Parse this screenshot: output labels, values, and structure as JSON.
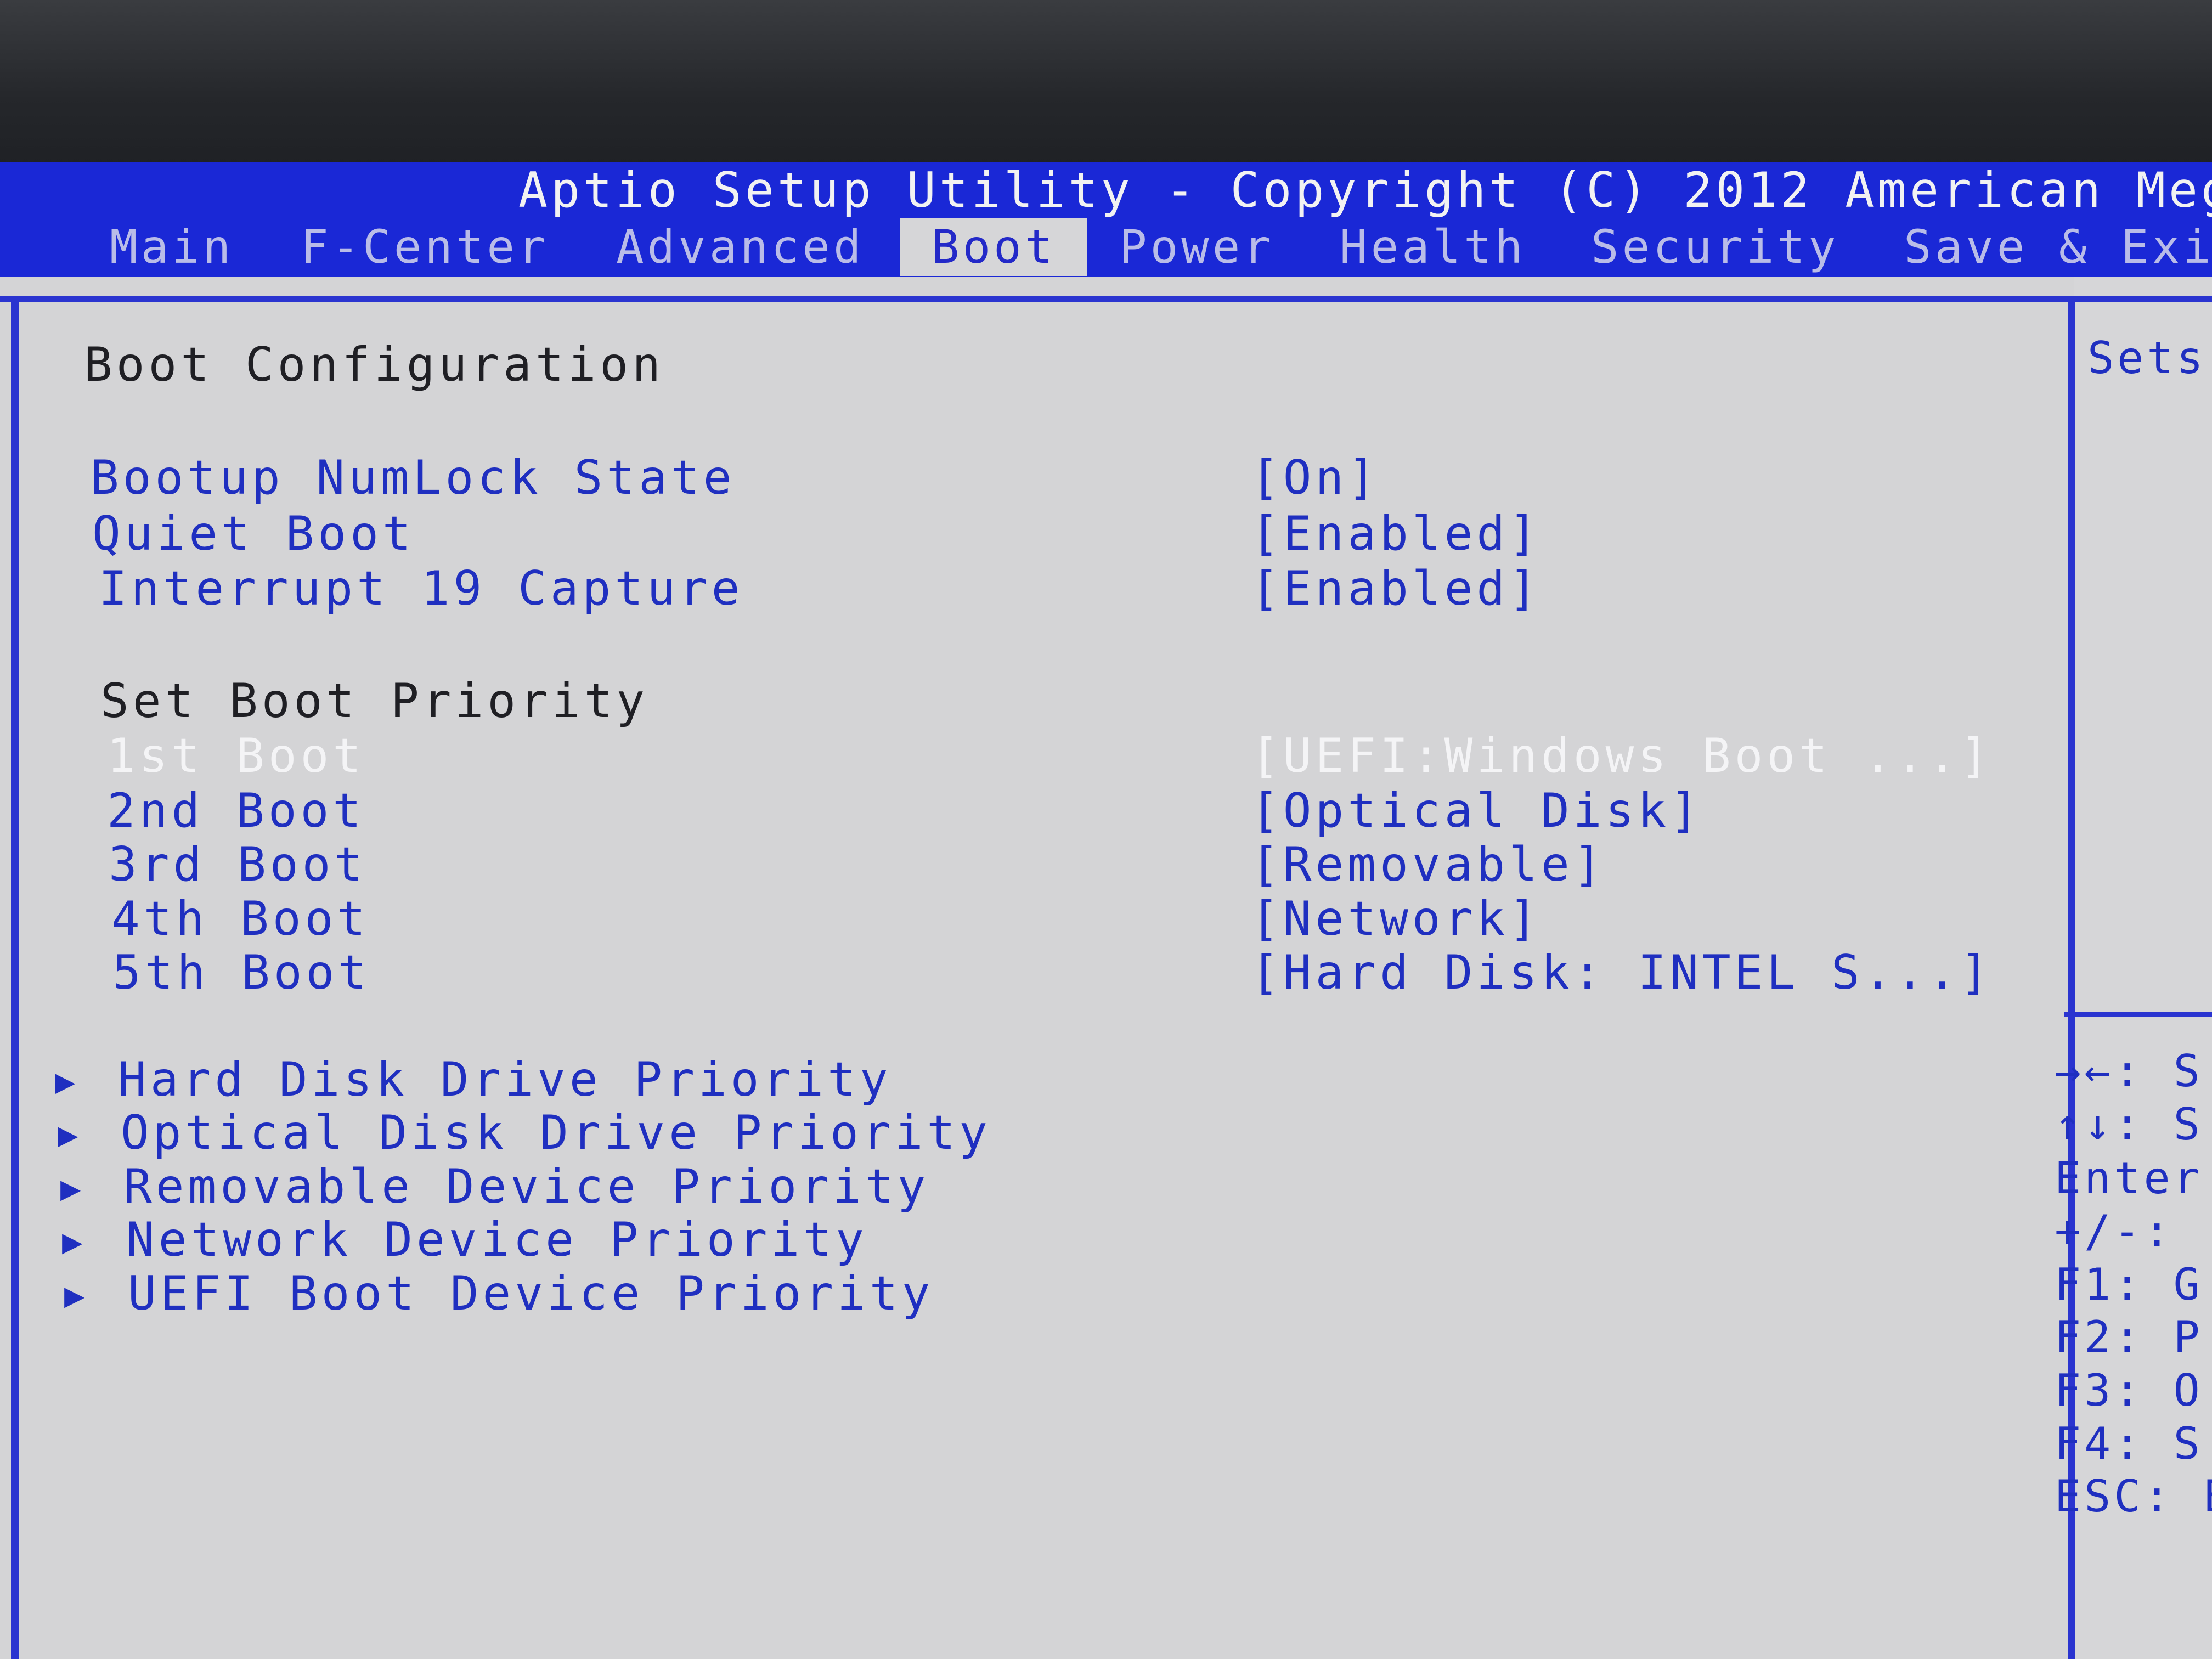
{
  "header": {
    "title": "Aptio Setup Utility - Copyright (C) 2012 American Mega",
    "tabs": [
      "Main",
      "F-Center",
      "Advanced",
      "Boot",
      "Power",
      "Health",
      "Security",
      "Save & Exi"
    ],
    "active_tab": "Boot"
  },
  "main": {
    "section_title": "Boot Configuration",
    "settings": [
      {
        "label": "Bootup NumLock State",
        "value": "[On]"
      },
      {
        "label": "Quiet Boot",
        "value": "[Enabled]"
      },
      {
        "label": "Interrupt 19 Capture",
        "value": "[Enabled]"
      }
    ],
    "priority_title": "Set Boot Priority",
    "boot_order": [
      {
        "label": "1st Boot",
        "value": "[UEFI:Windows Boot ...]"
      },
      {
        "label": "2nd Boot",
        "value": "[Optical Disk]"
      },
      {
        "label": "3rd Boot",
        "value": "[Removable]"
      },
      {
        "label": "4th Boot",
        "value": "[Network]"
      },
      {
        "label": "5th Boot",
        "value": "[Hard Disk: INTEL S...]"
      }
    ],
    "arrow_glyph": "▶",
    "submenus": [
      "Hard Disk Drive Priority",
      "Optical Disk Drive Priority",
      "Removable Device Priority",
      "Network Device Priority",
      "UEFI Boot Device Priority"
    ]
  },
  "side": {
    "help_text": "Sets",
    "keys": [
      "→←: S",
      "↑↓: S",
      "Enter",
      "+/-: ",
      "F1: G",
      "F2: P",
      "F3: O",
      "F4: S",
      "ESC: E"
    ]
  },
  "colors": {
    "header_blue": "#1a28d6",
    "panel_gray": "#d4d4d6",
    "item_blue": "#1f2fc0",
    "selected_white": "#f4f4f6"
  }
}
